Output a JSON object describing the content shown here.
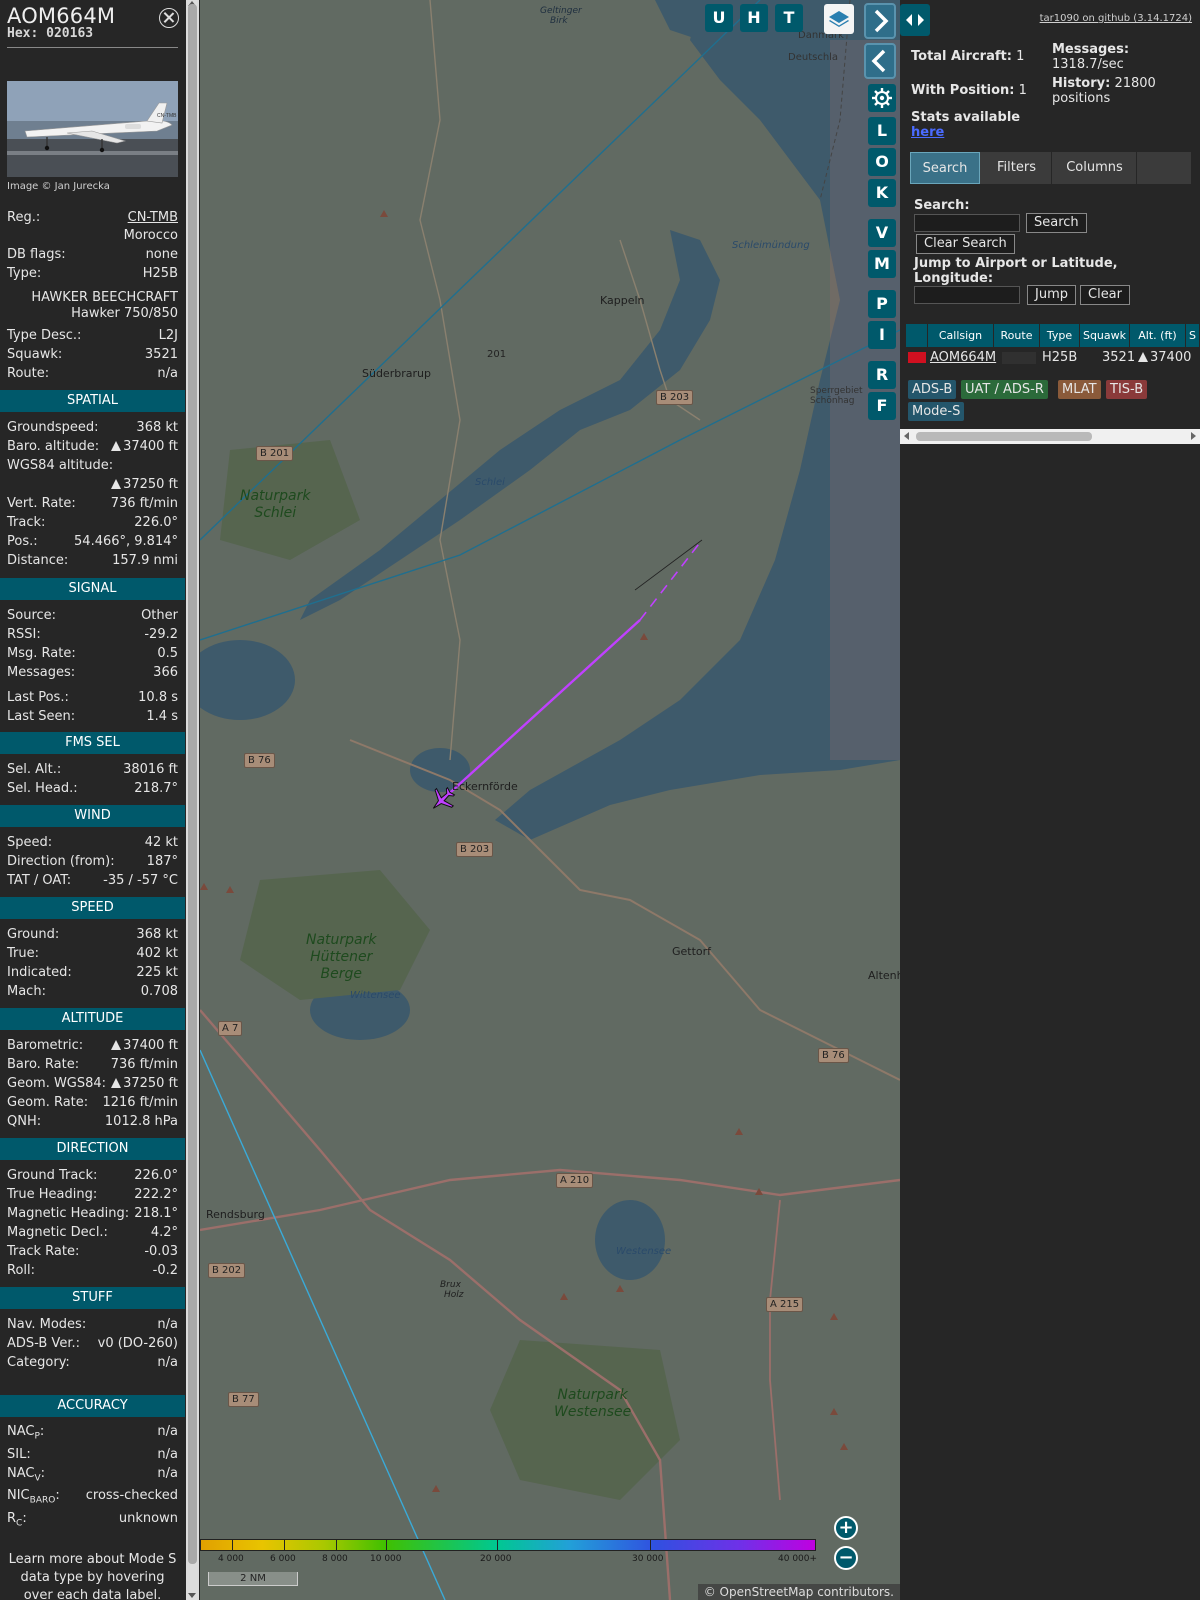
{
  "aircraft": {
    "callsign": "AOM664M",
    "hex_label": "Hex:",
    "hex": "020163",
    "photo_credit": "Image © Jan Jurecka",
    "photo_reg_text": "CN-TMB"
  },
  "info": {
    "reg_k": "Reg.:",
    "reg_v": "CN-TMB",
    "country_v": "Morocco",
    "dbflags_k": "DB flags:",
    "dbflags_v": "none",
    "type_k": "Type:",
    "type_v": "H25B",
    "type_full_1": "HAWKER BEECHCRAFT",
    "type_full_2": "Hawker 750/850",
    "typedesc_k": "Type Desc.:",
    "typedesc_v": "L2J",
    "squawk_k": "Squawk:",
    "squawk_v": "3521",
    "route_k": "Route:",
    "route_v": "n/a"
  },
  "spatial": {
    "title": "SPATIAL",
    "gs_k": "Groundspeed:",
    "gs_v": "368 kt",
    "baro_k": "Baro. altitude:",
    "baro_v": "37400 ft",
    "wgs_k": "WGS84 altitude:",
    "wgs_v": "37250 ft",
    "vr_k": "Vert. Rate:",
    "vr_v": "736 ft/min",
    "track_k": "Track:",
    "track_v": "226.0°",
    "pos_k": "Pos.:",
    "pos_v": "54.466°, 9.814°",
    "dist_k": "Distance:",
    "dist_v": "157.9 nmi"
  },
  "signal": {
    "title": "SIGNAL",
    "source_k": "Source:",
    "source_v": "Other",
    "rssi_k": "RSSI:",
    "rssi_v": "-29.2",
    "msgrate_k": "Msg. Rate:",
    "msgrate_v": "0.5",
    "messages_k": "Messages:",
    "messages_v": "366",
    "lastpos_k": "Last Pos.:",
    "lastpos_v": "10.8 s",
    "lastseen_k": "Last Seen:",
    "lastseen_v": "1.4 s"
  },
  "fms": {
    "title": "FMS SEL",
    "selalt_k": "Sel. Alt.:",
    "selalt_v": "38016 ft",
    "selhead_k": "Sel. Head.:",
    "selhead_v": "218.7°"
  },
  "wind": {
    "title": "WIND",
    "speed_k": "Speed:",
    "speed_v": "42 kt",
    "dir_k": "Direction (from):",
    "dir_v": "187°",
    "tat_k": "TAT / OAT:",
    "tat_v": "-35 / -57 °C"
  },
  "speed": {
    "title": "SPEED",
    "ground_k": "Ground:",
    "ground_v": "368 kt",
    "true_k": "True:",
    "true_v": "402 kt",
    "ind_k": "Indicated:",
    "ind_v": "225 kt",
    "mach_k": "Mach:",
    "mach_v": "0.708"
  },
  "altitude": {
    "title": "ALTITUDE",
    "baro_k": "Barometric:",
    "baro_v": "37400 ft",
    "bararate_k": "Baro. Rate:",
    "bararate_v": "736 ft/min",
    "geom_k": "Geom. WGS84:",
    "geom_v": "37250 ft",
    "geomrate_k": "Geom. Rate:",
    "geomrate_v": "1216 ft/min",
    "qnh_k": "QNH:",
    "qnh_v": "1012.8 hPa"
  },
  "direction": {
    "title": "DIRECTION",
    "gt_k": "Ground Track:",
    "gt_v": "226.0°",
    "th_k": "True Heading:",
    "th_v": "222.2°",
    "mh_k": "Magnetic Heading:",
    "mh_v": "218.1°",
    "md_k": "Magnetic Decl.:",
    "md_v": "4.2°",
    "tr_k": "Track Rate:",
    "tr_v": "-0.03",
    "roll_k": "Roll:",
    "roll_v": "-0.2"
  },
  "stuff": {
    "title": "STUFF",
    "nav_k": "Nav. Modes:",
    "nav_v": "n/a",
    "adsb_k": "ADS-B Ver.:",
    "adsb_v": "v0 (DO-260)",
    "cat_k": "Category:",
    "cat_v": "n/a"
  },
  "accuracy": {
    "title": "ACCURACY",
    "nacp_k": "NAC",
    "nacp_sub": "P",
    "nacp_v": "n/a",
    "sil_k": "SIL:",
    "sil_v": "n/a",
    "nacv_k": "NAC",
    "nacv_sub": "V",
    "nacv_v": "n/a",
    "nic_k": "NIC",
    "nic_sub": "BARO",
    "nic_v": "cross-checked",
    "rc_k": "R",
    "rc_sub": "C",
    "rc_v": "unknown",
    "colon": ":"
  },
  "info_note": "Learn more about Mode S data type by hovering over each data label.",
  "map": {
    "top_buttons": [
      "U",
      "H",
      "T"
    ],
    "side_buttons": [
      "L",
      "O",
      "K",
      "V",
      "M",
      "P",
      "I",
      "R",
      "F"
    ],
    "places": {
      "kappeln": "Kappeln",
      "suederbrarup": "Süderbrarup",
      "eckernfoerde": "Eckernförde",
      "gettorf": "Gettorf",
      "rendsburg": "Rendsburg",
      "altenh": "Altenh",
      "brux": "Brux",
      "holz": "Holz",
      "geltinger": "Geltinger",
      "birk": "Birk",
      "daenemark": "Danmark",
      "deutschland": "Deutschla",
      "sperrgebiet": "Sperrgebiet",
      "schoenhagen": "Schönhag"
    },
    "parks": {
      "schlei_1": "Naturpark",
      "schlei_2": "Schlei",
      "huettener_1": "Naturpark",
      "huettener_2": "Hüttener",
      "huettener_3": "Berge",
      "westensee_1": "Naturpark",
      "westensee_2": "Westensee"
    },
    "waters": {
      "schleimuendung": "Schleimündung",
      "schlei": "Schlei",
      "wittensee": "Wittensee",
      "westensee": "Westensee"
    },
    "roads": {
      "b203a": "B 203",
      "b201": "B 201",
      "b76a": "B 76",
      "b203b": "B 203",
      "b76b": "B 76",
      "a7": "A 7",
      "a210": "A 210",
      "b202": "B 202",
      "a215": "A 215",
      "b77": "B 77",
      "r201": "201"
    },
    "legend_labels": [
      "4 000",
      "6 000",
      "8 000",
      "10 000",
      "20 000",
      "30 000",
      "40 000+"
    ],
    "scale": "2 NM",
    "attribution": "© OpenStreetMap contributors."
  },
  "rpanel": {
    "github": "tar1090 on github (3.14.1724)",
    "total_k": "Total Aircraft:",
    "total_v": "1",
    "withpos_k": "With Position:",
    "withpos_v": "1",
    "messages_k": "Messages:",
    "messages_v": "1318.7/sec",
    "history_k": "History:",
    "history_v": "21800",
    "history_unit": "positions",
    "stats_text": "Stats available",
    "stats_link": "here",
    "tabs": [
      "Search",
      "Filters",
      "Columns"
    ],
    "search_label": "Search:",
    "search_btn": "Search",
    "clear_search_btn": "Clear Search",
    "jump_label": "Jump to Airport or Latitude, Longitude:",
    "jump_btn": "Jump",
    "clear_btn": "Clear",
    "table_headers": [
      "Callsign",
      "Route",
      "Type",
      "Squawk",
      "Alt. (ft)",
      "S"
    ],
    "row": {
      "callsign": "AOM664M",
      "type": "H25B",
      "squawk": "3521",
      "alt": "37400"
    },
    "badges": [
      "ADS-B",
      "UAT / ADS-R",
      "MLAT",
      "TIS-B",
      "Mode-S"
    ]
  },
  "colors": {
    "panel_bg": "#262626",
    "section_bg": "#00596b",
    "track": "#c040ff",
    "badge_adsb": "#24566b",
    "badge_uat": "#2b6a3a",
    "badge_mlat": "#8a5a3a",
    "badge_tisb": "#8a3a3a",
    "badge_modes": "#24566b"
  }
}
